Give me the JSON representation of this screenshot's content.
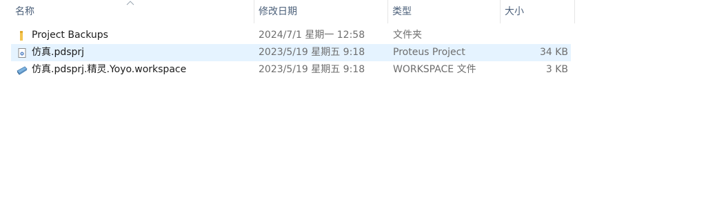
{
  "columns": {
    "name": "名称",
    "date": "修改日期",
    "type": "类型",
    "size": "大小"
  },
  "files": [
    {
      "name": "Project Backups",
      "date": "2024/7/1 星期一 12:58",
      "type": "文件夹",
      "size": "",
      "icon": "folder-icon",
      "selected": false
    },
    {
      "name": "仿真.pdsprj",
      "date": "2023/5/19 星期五 9:18",
      "type": "Proteus Project",
      "size": "34 KB",
      "icon": "proteus-project-icon",
      "selected": true
    },
    {
      "name": "仿真.pdsprj.精灵.Yoyo.workspace",
      "date": "2023/5/19 星期五 9:18",
      "type": "WORKSPACE 文件",
      "size": "3 KB",
      "icon": "workspace-file-icon",
      "selected": false
    }
  ],
  "colors": {
    "header_text": "#4c607a",
    "selection": "#e5f3ff",
    "folder": "#f4c44e"
  }
}
